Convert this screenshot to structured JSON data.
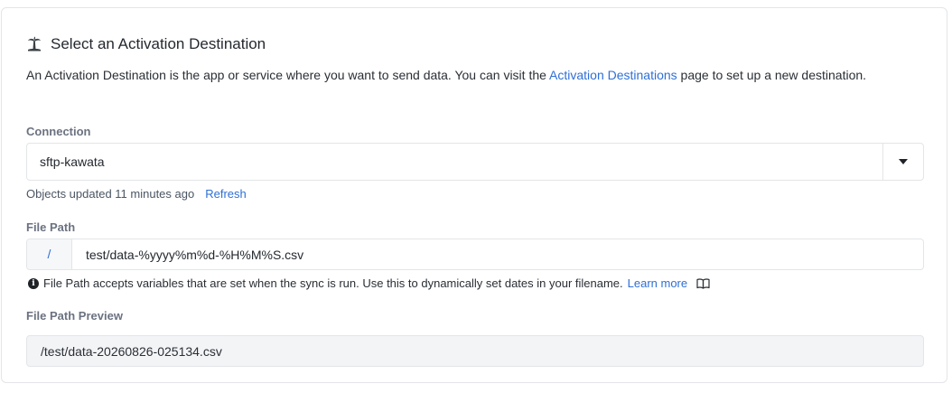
{
  "header": {
    "title": "Select an Activation Destination",
    "icon": "palm-tree-icon"
  },
  "description": {
    "before_link": "An Activation Destination is the app or service where you want to send data. You can visit the ",
    "link_text": "Activation Destinations",
    "after_link": " page to set up a new destination."
  },
  "connection": {
    "label": "Connection",
    "selected_value": "sftp-kawata",
    "updated_text": "Objects updated 11 minutes ago",
    "refresh_label": "Refresh"
  },
  "file_path": {
    "label": "File Path",
    "prefix": "/",
    "value": "test/data-%yyyy%m%d-%H%M%S.csv",
    "hint": "File Path accepts variables that are set when the sync is run. Use this to dynamically set dates in your filename.",
    "learn_more_label": "Learn more"
  },
  "file_path_preview": {
    "label": "File Path Preview",
    "value": "/test/data-20260826-025134.csv"
  },
  "colors": {
    "link": "#2f6fd6",
    "label": "#6b7280",
    "border": "#e3e5e8",
    "preview_bg": "#f3f4f6"
  }
}
